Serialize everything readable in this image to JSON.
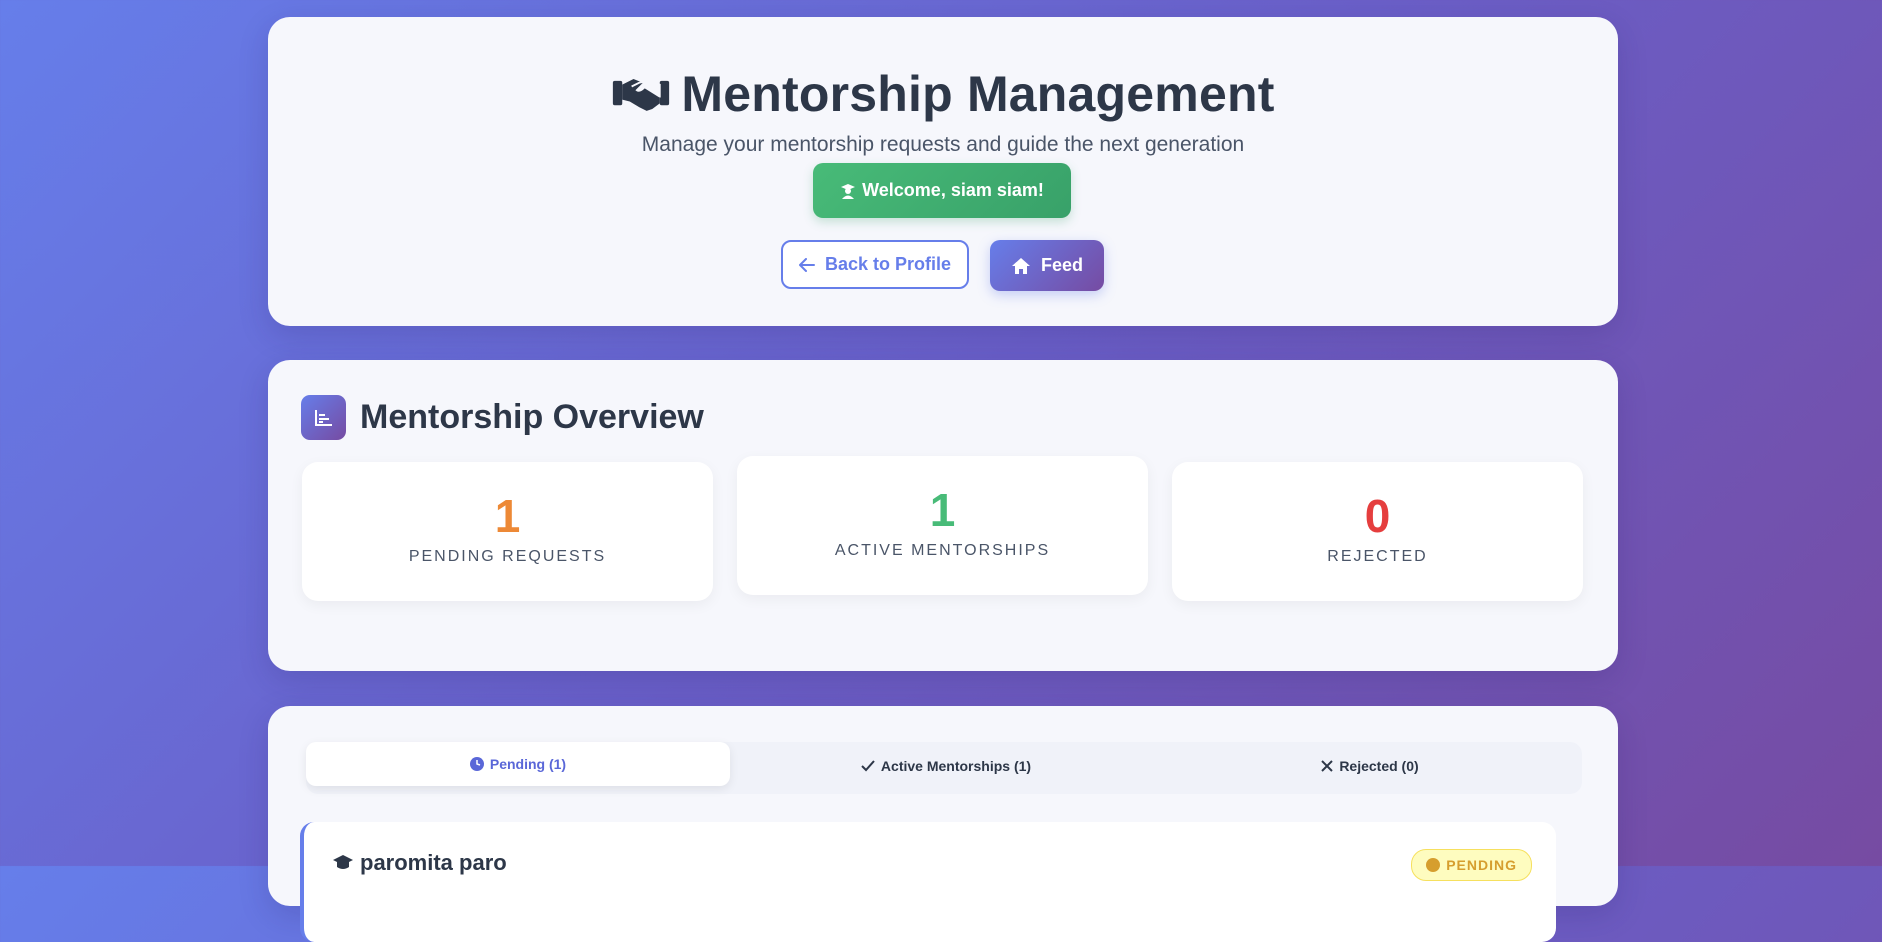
{
  "header": {
    "title": "Mentorship Management",
    "title_icon": "handshake-icon",
    "subtitle": "Manage your mentorship requests and guide the next generation",
    "welcome": "Welcome, siam siam!",
    "back_label": "Back to Profile",
    "feed_label": "Feed"
  },
  "overview": {
    "title": "Mentorship Overview",
    "stats": [
      {
        "value": "1",
        "label": "PENDING REQUESTS",
        "color": "#ed8936"
      },
      {
        "value": "1",
        "label": "ACTIVE MENTORSHIPS",
        "color": "#48bb78"
      },
      {
        "value": "0",
        "label": "REJECTED",
        "color": "#e53e3e"
      }
    ]
  },
  "tabs": [
    {
      "label": "Pending (1)",
      "active": true
    },
    {
      "label": "Active Mentorships (1)",
      "active": false
    },
    {
      "label": "Rejected (0)",
      "active": false
    }
  ],
  "requests": [
    {
      "name": "paromita paro",
      "status": "PENDING"
    }
  ],
  "colors": {
    "accent": "#667eea",
    "accent2": "#764ba2",
    "success": "#48bb78",
    "warning": "#ed8936",
    "danger": "#e53e3e"
  }
}
